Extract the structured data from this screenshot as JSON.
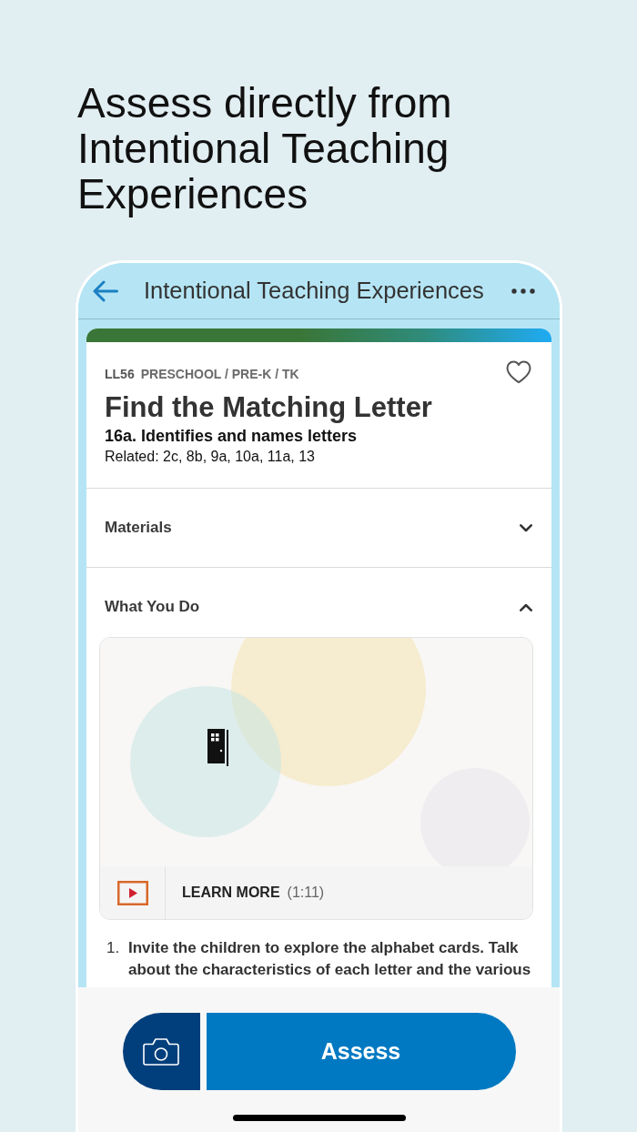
{
  "headline": "Assess directly from Intentional Teaching Experiences",
  "app_bar": {
    "title": "Intentional Teaching Experiences"
  },
  "activity": {
    "code": "LL56",
    "grade_band": "PRESCHOOL / PRE-K / TK",
    "title": "Find the Matching Letter",
    "objective": "16a. Identifies and names letters",
    "related": "Related: 2c, 8b, 9a, 10a, 11a, 13",
    "favorited": false
  },
  "sections": [
    {
      "title": "Materials",
      "expanded": false
    },
    {
      "title": "What You Do",
      "expanded": true,
      "video": {
        "action": "LEARN MORE",
        "duration": "(1:11)"
      },
      "steps": [
        {
          "number": "1.",
          "text": "Invite the children to explore the alphabet cards. Talk about the characteristics of each letter and the various"
        }
      ]
    }
  ],
  "footer_buttons": [
    {
      "kind": "camera"
    },
    {
      "kind": "primary",
      "label": "Assess"
    }
  ]
}
